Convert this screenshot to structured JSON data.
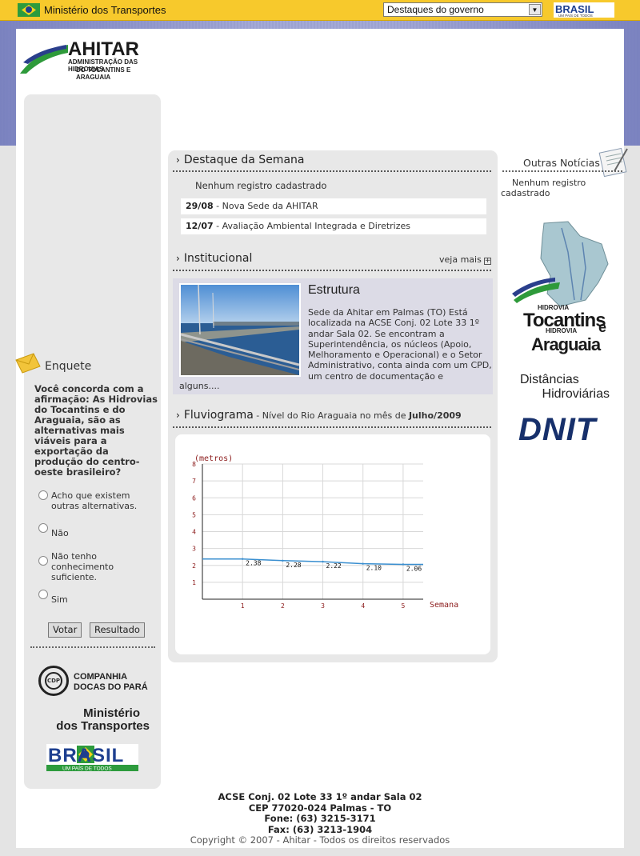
{
  "topbar": {
    "ministry_label": "Ministério dos Transportes",
    "dropdown_selected": "Destaques do governo",
    "brasil_logo": "BRASIL",
    "brasil_tagline": "UM PAÍS DE TODOS"
  },
  "logo": {
    "name": "AHITAR",
    "subtitle_line1": "ADMINISTRAÇÃO DAS HIDROVIAS",
    "subtitle_line2": "DO TOCANTINS E ARAGUAIA"
  },
  "destaque": {
    "heading": "Destaque da Semana",
    "empty_text": "Nenhum registro cadastrado",
    "items": [
      {
        "date": "29/08",
        "title": "Nova Sede da AHITAR"
      },
      {
        "date": "12/07",
        "title": "Avaliação Ambiental Integrada e Diretrizes"
      }
    ]
  },
  "institucional": {
    "heading": "Institucional",
    "veja_mais": "veja mais",
    "article_title": "Estrutura",
    "article_text": "Sede da Ahitar em Palmas (TO) Está localizada na ACSE Conj. 02 Lote 33 1º andar Sala 02. Se encontram a Superintendência, os núcleos (Apoio, Melhoramento e Operacional) e o Setor Administrativo, conta ainda com um CPD, um centro de documentação e",
    "article_tail": "alguns...."
  },
  "fluviograma": {
    "heading": "Fluviograma",
    "sub_prefix": " - Nível do Rio Araguaia no mês de ",
    "sub_bold": "Julho/2009"
  },
  "chart_data": {
    "type": "line",
    "ylabel": "(metros)",
    "xlabel": "Semana",
    "x": [
      1,
      2,
      3,
      4,
      5
    ],
    "values": [
      2.38,
      2.28,
      2.22,
      2.1,
      2.06
    ],
    "value_labels": [
      "2.38",
      "2.28",
      "2.22",
      "2.10",
      "2.06"
    ],
    "ylim": [
      0,
      8
    ],
    "xlim": [
      0,
      5.5
    ],
    "yticks": [
      "1",
      "2",
      "3",
      "4",
      "5",
      "6",
      "7",
      "8"
    ],
    "xticks": [
      "1",
      "2",
      "3",
      "4",
      "5"
    ],
    "grid": true,
    "line_color": "#3a8fd0",
    "label_color": "#8b1a1a"
  },
  "enquete": {
    "heading": "Enquete",
    "question": "Você concorda com a afirmação: As Hidrovias do Tocantins e do Araguaia, são as alternativas mais viáveis para a exportação da produção do centro-oeste brasileiro?",
    "options": [
      "Acho que existem outras alternativas.",
      "Não",
      "Não tenho conhecimento suficiente.",
      "Sim"
    ],
    "vote_button": "Votar",
    "result_button": "Resultado"
  },
  "partners": {
    "cdp_line1": "COMPANHIA",
    "cdp_line2": "DOCAS DO PARÁ",
    "cdp_mark": "CDP",
    "mt_line1": "Ministério",
    "mt_line2": "dos Transportes",
    "brasil": "BRASIL",
    "brasil_tagline": "UM PAÍS DE TODOS"
  },
  "right": {
    "outras_heading": "Outras Notícias",
    "outras_empty": "Nenhum registro cadastrado",
    "outras_empty_l1": "Nenhum registro",
    "outras_empty_l2": "cadastrado",
    "hidrovia_top": "HIDROVIA",
    "hidrovia_tocantins": "Tocantins",
    "hidrovia_mid": "HIDROVIA",
    "hidrovia_e": "e",
    "hidrovia_araguaia": "Araguaia",
    "dist_line1": "Distâncias",
    "dist_line2": "Hidroviárias",
    "dnit": "DNIT"
  },
  "footer": {
    "address": "ACSE Conj. 02 Lote 33 1º andar Sala 02",
    "cep": "CEP 77020-024 Palmas - TO",
    "fone": "Fone: (63) 3215-3171",
    "fax": "Fax: (63) 3213-1904",
    "copyright": "Copyright © 2007 - Ahitar - Todos os direitos reservados"
  }
}
